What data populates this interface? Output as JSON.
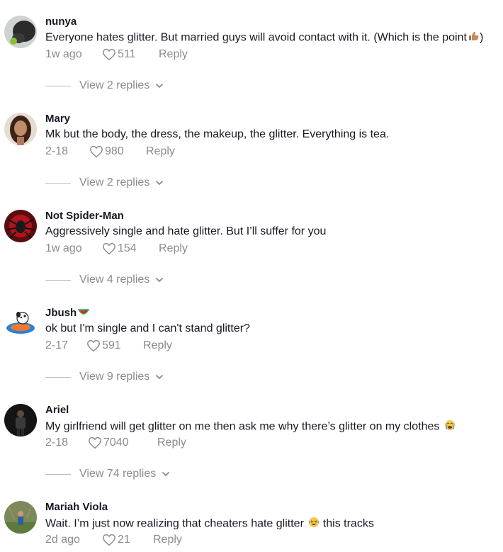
{
  "comments": [
    {
      "username": "nunya",
      "text": "Everyone hates glitter. But married guys will avoid contact with it. (Which is the point",
      "text_after": ")",
      "emoji": "thumbs-up-emoji",
      "time": "1w ago",
      "likes": "511",
      "reply_label": "Reply",
      "view_replies": "View 2 replies",
      "avatar": "dark-dog-avatar"
    },
    {
      "username": "Mary",
      "text": "Mk but the body, the dress, the makeup, the glitter. Everything is tea.",
      "time": "2-18",
      "likes": "980",
      "reply_label": "Reply",
      "view_replies": "View 2 replies",
      "avatar": "woman-portrait-avatar"
    },
    {
      "username": "Not Spider-Man",
      "text": "Aggressively single and hate glitter. But I’ll suffer for you",
      "time": "1w ago",
      "likes": "154",
      "reply_label": "Reply",
      "view_replies": "View 4 replies",
      "avatar": "red-spider-avatar"
    },
    {
      "username": "Jbush",
      "username_emoji": "watermelon-emoji",
      "text": "ok but I'm single and I can't stand glitter?",
      "time": "2-17",
      "likes": "591",
      "reply_label": "Reply",
      "view_replies": "View 9 replies",
      "avatar": "cartoon-dog-avatar"
    },
    {
      "username": "Ariel",
      "text": "My girlfriend will get glitter on me then ask me why there’s glitter on my clothes",
      "emoji": "crying-emoji",
      "time": "2-18",
      "likes": "7040",
      "reply_label": "Reply",
      "view_replies": "View 74 replies",
      "avatar": "dark-figure-avatar"
    },
    {
      "username": "Mariah Viola",
      "text": "Wait. I’m just now realizing that cheaters hate glitter",
      "text_after": " this tracks",
      "emoji": "laughing-emoji",
      "time": "2d ago",
      "likes": "21",
      "reply_label": "Reply",
      "avatar": "outdoor-person-avatar"
    }
  ],
  "colors": {
    "primary_text": "#161823",
    "secondary_text": "#8a8b91"
  }
}
